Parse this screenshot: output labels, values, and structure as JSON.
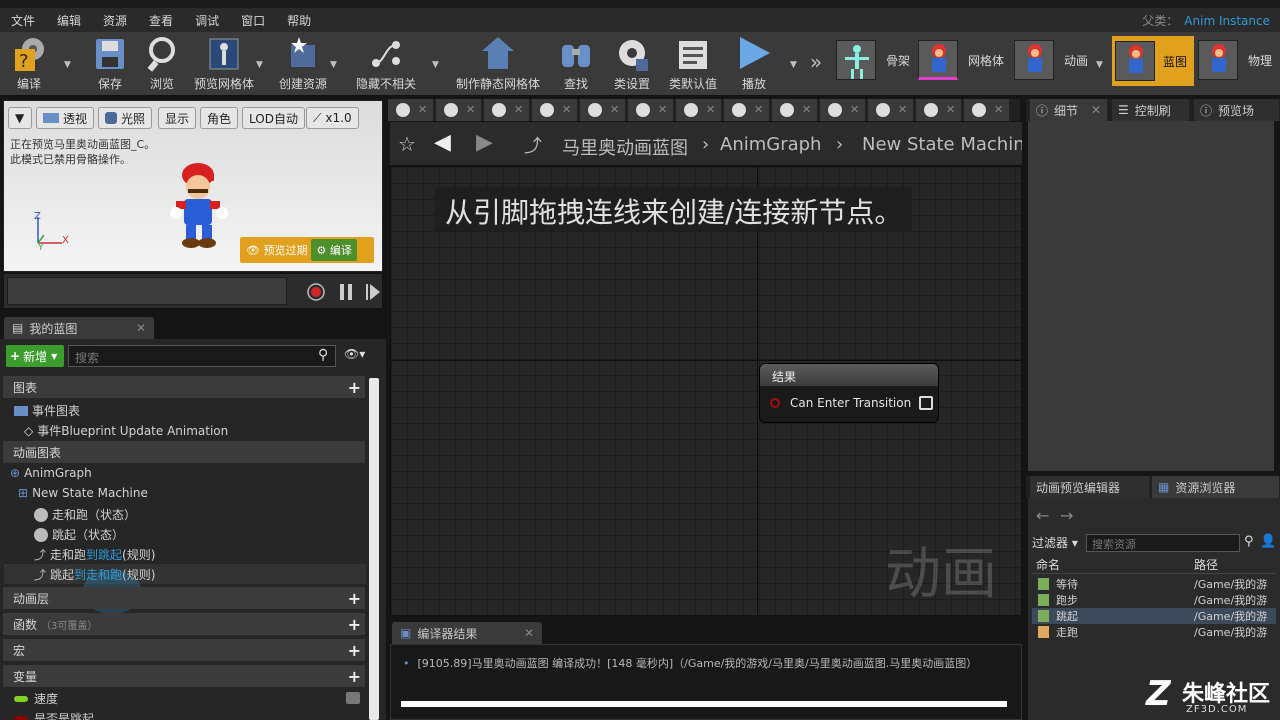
{
  "menu": [
    "文件",
    "编辑",
    "资源",
    "查看",
    "调试",
    "窗口",
    "帮助"
  ],
  "parent_class": {
    "label": "父类：",
    "value": "Anim Instance"
  },
  "toolbar": {
    "compile": "编译",
    "save": "保存",
    "browse": "浏览",
    "preview_mesh": "预览网格体",
    "create_asset": "创建资源",
    "hide_unrelated": "隐藏不相关",
    "make_static_mesh": "制作静态网格体",
    "find": "查找",
    "class_settings": "类设置",
    "class_defaults": "类默认值",
    "play": "播放",
    "more": "»"
  },
  "modes": {
    "skeleton": "骨架",
    "mesh": "网格体",
    "animation": "动画",
    "blueprint": "蓝图",
    "physics": "物理"
  },
  "viewport": {
    "btn_perspective": "透视",
    "btn_lit": "光照",
    "btn_show": "显示",
    "btn_character": "角色",
    "btn_lod": "LOD自动",
    "btn_speed": "x1.0",
    "info_line1": "正在预览马里奥动画蓝图_C。",
    "info_line2": "此模式已禁用骨骼操作。",
    "preview_expired": "预览过期",
    "compile": "编译",
    "axis_z": "Z",
    "axis_x": "X",
    "axis_y": "Y"
  },
  "my_blueprint": {
    "tab": "我的蓝图",
    "new_btn": "新增",
    "search_placeholder": "搜索",
    "section_graphs": "图表",
    "event_graph": "事件图表",
    "event_update": "事件Blueprint Update Animation",
    "section_anim_graphs": "动画图表",
    "anim_graph": "AnimGraph",
    "state_machine": "New State Machine",
    "state_walk_run": "走和跑（状态）",
    "state_jump": "跳起（状态）",
    "rule1_a": "走和跑",
    "rule1_b": "到跳起",
    "rule1_c": "(规则)",
    "rule2_a": "跳起",
    "rule2_b": "到走和跑",
    "rule2_c": "(规则)",
    "section_layers": "动画层",
    "section_functions": "函数",
    "functions_sub": "（3可覆盖）",
    "section_macros": "宏",
    "section_variables": "变量",
    "var_speed": "速度",
    "var_is_jumping": "是否是跳起"
  },
  "graph_tabs_count": 13,
  "breadcrumb": {
    "bp_name": "马里奥动画蓝图",
    "sep1": "›",
    "anim_graph": "AnimGraph",
    "sep2": "›",
    "state_machine": "New State Machine"
  },
  "graph": {
    "hint": "从引脚拖拽连线来创建/连接新节点。",
    "node_title": "结果",
    "pin_label": "Can Enter Transition",
    "watermark": "动画"
  },
  "compiler": {
    "tab": "编译器结果",
    "message": "[9105.89]马里奥动画蓝图 编译成功！[148 毫秒内]（/Game/我的游戏/马里奥/马里奥动画蓝图.马里奥动画蓝图）"
  },
  "right_tabs": {
    "details": "细节",
    "control": "控制刷",
    "preview": "预览场"
  },
  "asset_tabs": {
    "anim_preview": "动画预览编辑器",
    "asset_browser": "资源浏览器"
  },
  "asset_browser": {
    "filter": "过滤器",
    "search_placeholder": "搜索资源",
    "col_name": "命名",
    "col_path": "路径",
    "rows": [
      {
        "name": "等待",
        "path": "/Game/我的游"
      },
      {
        "name": "跑步",
        "path": "/Game/我的游"
      },
      {
        "name": "跳起",
        "path": "/Game/我的游"
      },
      {
        "name": "走跑",
        "path": "/Game/我的游"
      }
    ]
  },
  "logo": {
    "main": "朱峰社区",
    "sub": "ZF3D.COM"
  },
  "colors": {
    "accent_blue": "#2f9bd8",
    "new_green": "#3c9c2e",
    "preview_orange": "#e2a11d"
  }
}
